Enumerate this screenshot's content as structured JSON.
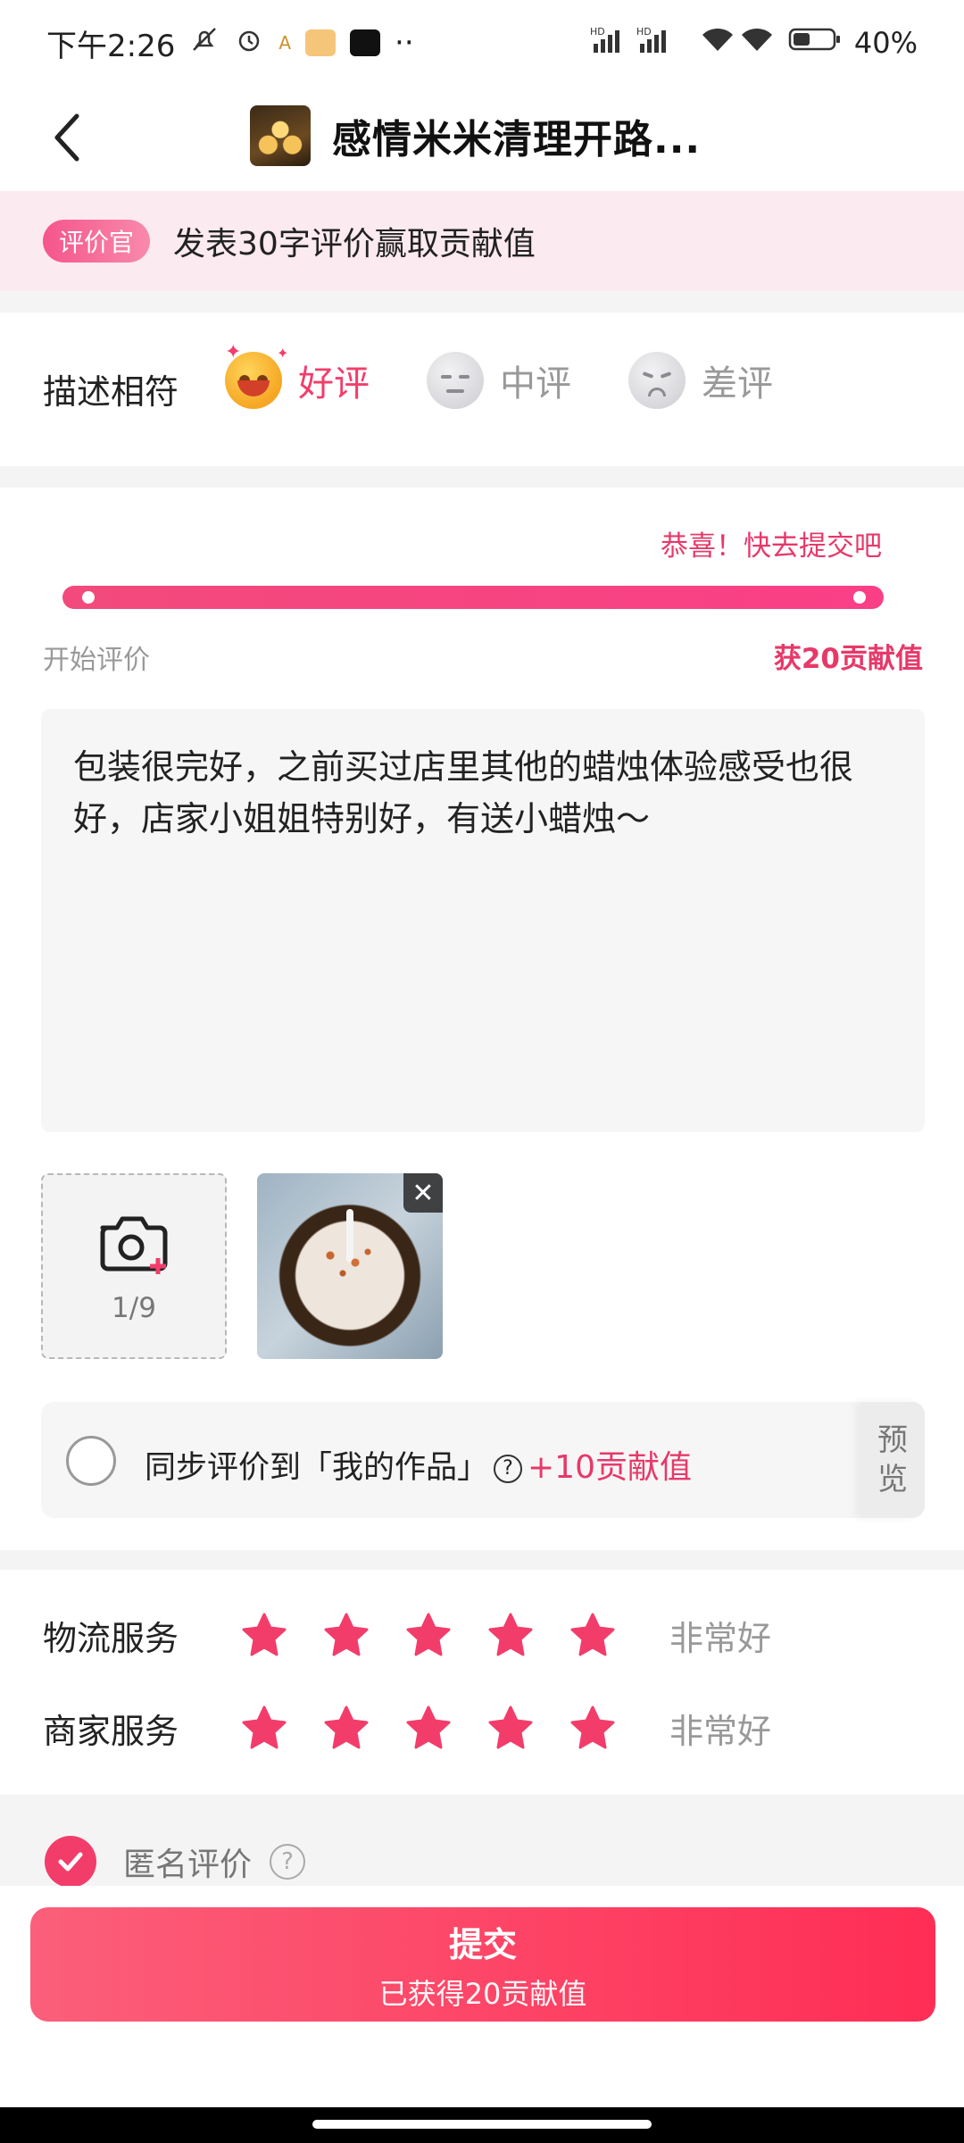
{
  "status_bar": {
    "time": "下午2:26",
    "icons": [
      "mute-icon",
      "alarm-icon",
      "app-icon",
      "mail-icon",
      "capcut-icon",
      "more-icon"
    ],
    "network": "HD",
    "battery": "40%"
  },
  "nav": {
    "back_icon": "chevron-left-icon",
    "title": "感情米米清理开路..."
  },
  "banner": {
    "badge": "评价官",
    "text": "发表30字评价赢取贡献值"
  },
  "rating": {
    "label": "描述相符",
    "options": [
      {
        "label": "好评",
        "icon": "happy-face-icon",
        "selected": true
      },
      {
        "label": "中评",
        "icon": "neutral-face-icon",
        "selected": false
      },
      {
        "label": "差评",
        "icon": "sad-face-icon",
        "selected": false
      }
    ]
  },
  "progress": {
    "message": "恭喜！快去提交吧",
    "start_label": "开始评价",
    "reward_label": "获20贡献值",
    "fill_fraction": 1.0
  },
  "review": {
    "text": "包装很完好，之前买过店里其他的蜡烛体验感受也很好，店家小姐姐特别好，有送小蜡烛～"
  },
  "media": {
    "upload_icon": "camera-add-icon",
    "count": "1/9",
    "photo_alt": "candle-photo"
  },
  "sync": {
    "text": "同步评价到「我的作品」",
    "help": "?",
    "reward": "+10贡献值",
    "preview": [
      "预",
      "览"
    ]
  },
  "services": [
    {
      "label": "物流服务",
      "stars": 5,
      "value": "非常好"
    },
    {
      "label": "商家服务",
      "stars": 5,
      "value": "非常好"
    }
  ],
  "anonymous": {
    "label": "匿名评价",
    "checked": true,
    "help": "?"
  },
  "submit": {
    "main": "提交",
    "sub": "已获得20贡献值"
  },
  "colors": {
    "accent": "#f23d6b",
    "banner_bg": "#fbeaf0",
    "muted": "#999999"
  }
}
